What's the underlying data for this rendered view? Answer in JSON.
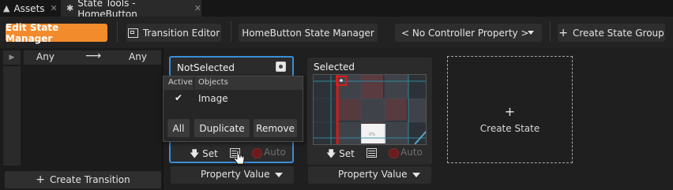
{
  "tabs": [
    {
      "label": "Assets",
      "icon": "assets-icon"
    },
    {
      "label": "State Tools - HomeButton",
      "icon": "state-tools-icon",
      "active": true
    }
  ],
  "toolbar": {
    "edit_state_manager": "Edit State Manager",
    "transition_editor": "Transition Editor",
    "state_manager_name": "HomeButton State Manager",
    "controller_property": "< No Controller Property >",
    "create_state_group": "Create State Group"
  },
  "transitions": {
    "from": "Any",
    "to": "Any",
    "create_label": "Create Transition"
  },
  "states": [
    {
      "name": "NotSelected",
      "selected": true,
      "set_label": "Set",
      "auto_label": "Auto",
      "property_value": "Property Value"
    },
    {
      "name": "Selected",
      "selected": false,
      "set_label": "Set",
      "auto_label": "Auto",
      "property_value": "Property Value"
    }
  ],
  "create_state": {
    "plus": "+",
    "label": "Create State"
  },
  "popup": {
    "col_active": "Active",
    "col_objects": "Objects",
    "rows": [
      {
        "active": true,
        "object": "Image"
      }
    ],
    "buttons": {
      "all": "All",
      "duplicate": "Duplicate",
      "remove": "Remove"
    }
  },
  "colors": {
    "accent_orange": "#f28b2c",
    "selection_blue": "#3a8ed8",
    "background": "#1f1f1f"
  }
}
